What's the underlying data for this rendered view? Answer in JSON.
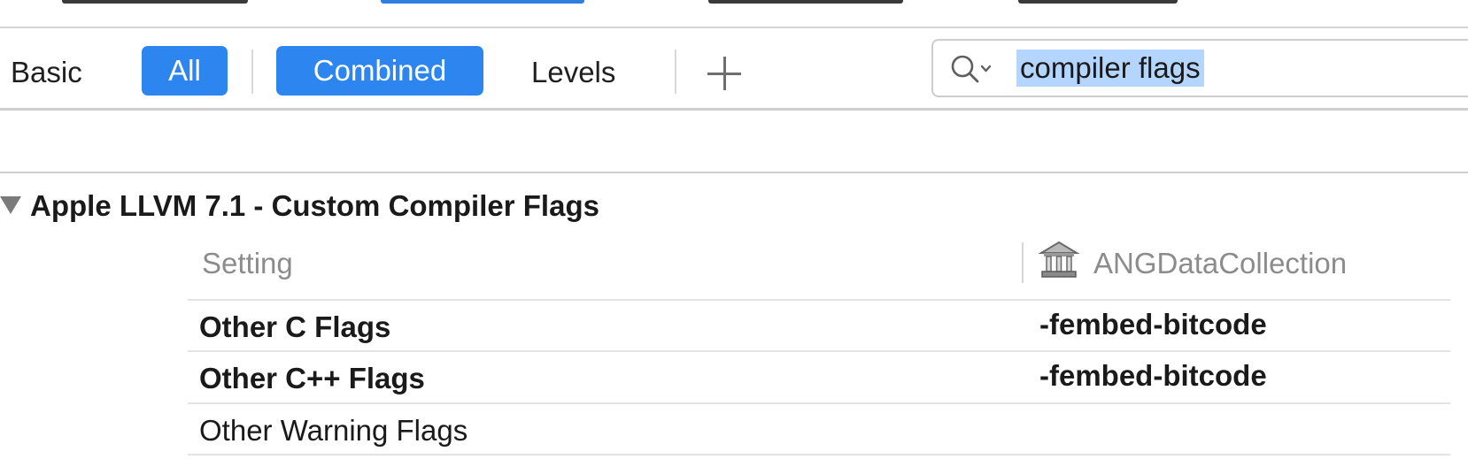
{
  "filter_bar": {
    "scope_tabs": [
      "Basic",
      "All"
    ],
    "selected_scope": "All",
    "view_tabs": [
      "Combined",
      "Levels"
    ],
    "selected_view": "Combined",
    "search": {
      "value": "compiler flags"
    }
  },
  "section": {
    "title": "Apple LLVM 7.1 - Custom Compiler Flags",
    "expanded": true
  },
  "table": {
    "column_setting": "Setting",
    "column_target": "ANGDataCollection",
    "rows": [
      {
        "setting": "Other C Flags",
        "value": "-fembed-bitcode",
        "bold": true
      },
      {
        "setting": "Other C++ Flags",
        "value": "-fembed-bitcode",
        "bold": true
      },
      {
        "setting": "Other Warning Flags",
        "value": "",
        "bold": false
      }
    ]
  },
  "colors": {
    "accent": "#2d86f0",
    "selection_highlight": "#b4d5fe"
  }
}
